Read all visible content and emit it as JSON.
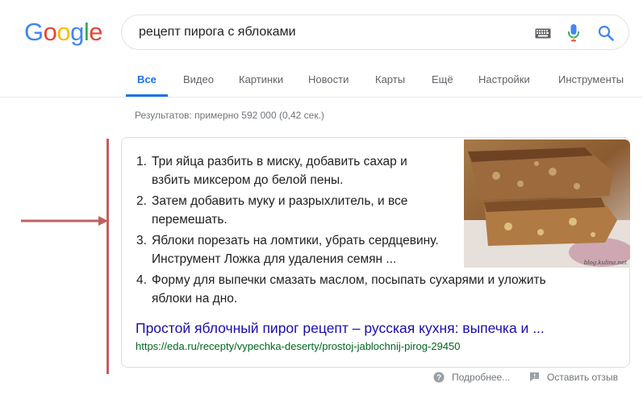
{
  "logo": {
    "letters": [
      "G",
      "o",
      "o",
      "g",
      "l",
      "e"
    ],
    "colors": [
      "#4285F4",
      "#EA4335",
      "#FBBC05",
      "#4285F4",
      "#34A853",
      "#EA4335"
    ]
  },
  "search": {
    "query": "рецепт пирога с яблоками"
  },
  "tabs": [
    {
      "label": "Все",
      "active": true
    },
    {
      "label": "Видео"
    },
    {
      "label": "Картинки"
    },
    {
      "label": "Новости"
    },
    {
      "label": "Карты"
    },
    {
      "label": "Ещё"
    },
    {
      "label": "Настройки"
    },
    {
      "label": "Инструменты"
    }
  ],
  "stats": "Результатов: примерно 592 000 (0,42 сек.)",
  "snippet": {
    "steps": [
      {
        "num": "1.",
        "lines": [
          "Три яйца разбить в миску, добавить сахар и",
          "взбить миксером до белой пены."
        ]
      },
      {
        "num": "2.",
        "lines": [
          "Затем добавить муку и разрыхлитель, и все",
          "перемешать."
        ]
      },
      {
        "num": "3.",
        "lines": [
          "Яблоки порезать на ломтики, убрать сердцевину.",
          "Инструмент Ложка для удаления семян ..."
        ]
      },
      {
        "num": "4.",
        "lines": [
          "Форму для выпечки смазать маслом, посыпать сухарями и уложить",
          "яблоки на дно."
        ]
      }
    ],
    "image_watermark": "blog.kulina.net",
    "title": "Простой яблочный пирог рецепт – русская кухня: выпечка и ...",
    "url": "https://eda.ru/recepty/vypechka-deserty/prostoj-jablochnij-pirog-29450"
  },
  "footer": {
    "more": "Подробнее...",
    "feedback": "Оставить отзыв"
  },
  "colors": {
    "accent": "#1a73e8",
    "link": "#1a0dab",
    "url": "#006621",
    "annotation": "#c0605e"
  }
}
